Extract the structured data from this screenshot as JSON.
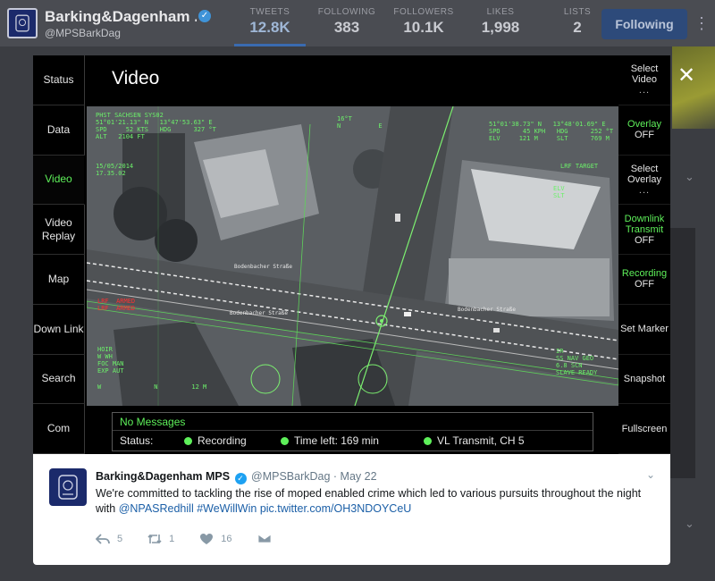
{
  "profile": {
    "name": "Barking&Dagenham ...",
    "handle": "@MPSBarkDag",
    "stats": [
      {
        "label": "TWEETS",
        "value": "12.8K"
      },
      {
        "label": "FOLLOWING",
        "value": "383"
      },
      {
        "label": "FOLLOWERS",
        "value": "10.1K"
      },
      {
        "label": "LIKES",
        "value": "1,998"
      },
      {
        "label": "LISTS",
        "value": "2"
      }
    ],
    "following_label": "Following"
  },
  "device": {
    "title": "Video",
    "left_menu": [
      "Status",
      "Data",
      "Video",
      "Video Replay",
      "Map",
      "Down Link",
      "Search",
      "Com"
    ],
    "right_menu": [
      {
        "label": "Select Video",
        "sub": "",
        "dots": "...",
        "green": false
      },
      {
        "label": "Overlay",
        "sub": "OFF",
        "dots": "",
        "green": true
      },
      {
        "label": "Select Overlay",
        "sub": "",
        "dots": "...",
        "green": false
      },
      {
        "label": "Downlink Transmit",
        "sub": "OFF",
        "dots": "",
        "green": true
      },
      {
        "label": "Recording",
        "sub": "OFF",
        "dots": "",
        "green": true
      },
      {
        "label": "Set Marker",
        "sub": "",
        "dots": "",
        "green": false
      },
      {
        "label": "Snapshot",
        "sub": "",
        "dots": "",
        "green": false
      },
      {
        "label": "Fullscreen",
        "sub": "",
        "dots": "",
        "green": false
      }
    ],
    "hud": {
      "top_left": "PHST SACHSEN SYS02\n51°01'21.13\" N   13°47'53.63\" E\nSPD     52 KTS   HDG      327 °T\nALT   2104 FT",
      "date": "15/05/2014\n17.35.02",
      "top_center": "16°T\nN          E",
      "top_right": "51°01'38.73\" N   13°48'01.69\" E\nSPD      45 KPH   HDG      252 °T\nELV     121 M     SLT      769 M",
      "lrf": "LRF TARGET",
      "elv": "ELV\nSLT",
      "red": "LRF  ARMED\nLRF  ARMED",
      "bottom_left": "HOIR\nW WH\nFOC MAN\nEXP AUT",
      "bottom_scale": "W              N         12 M",
      "bottom_right": "IR\nSS NAV GEO\n6.8 SCN\nSLAVE READY",
      "street_1": "Bodenbacher Straße",
      "street_2": "Bodenbacher Straße",
      "street_3": "Bodenbacher Straße"
    },
    "status_panel": {
      "messages": "No Messages",
      "status_label": "Status:",
      "items": [
        "Recording",
        "Time left: 169 min",
        "VL Transmit, CH 5"
      ]
    }
  },
  "tweet": {
    "name": "Barking&Dagenham MPS",
    "handle": "@MPSBarkDag",
    "date": "· May 22",
    "text": "We're committed to tackling the rise of moped enabled crime which led to various pursuits throughout the night with ",
    "mention": "@NPASRedhill",
    "hashtag": "#WeWillWin",
    "link": "pic.twitter.com/OH3NDOYCeU",
    "reply_count": "5",
    "retweet_count": "1",
    "like_count": "16"
  },
  "colors": {
    "hud_green": "#5ef05a",
    "accent_blue": "#1b5fa7",
    "police_blue": "#1b2a6b"
  },
  "icons": [
    "close-icon",
    "verified-icon",
    "reply-icon",
    "retweet-icon",
    "like-icon",
    "direct-message-icon",
    "chevron-down-icon",
    "more-icon"
  ]
}
